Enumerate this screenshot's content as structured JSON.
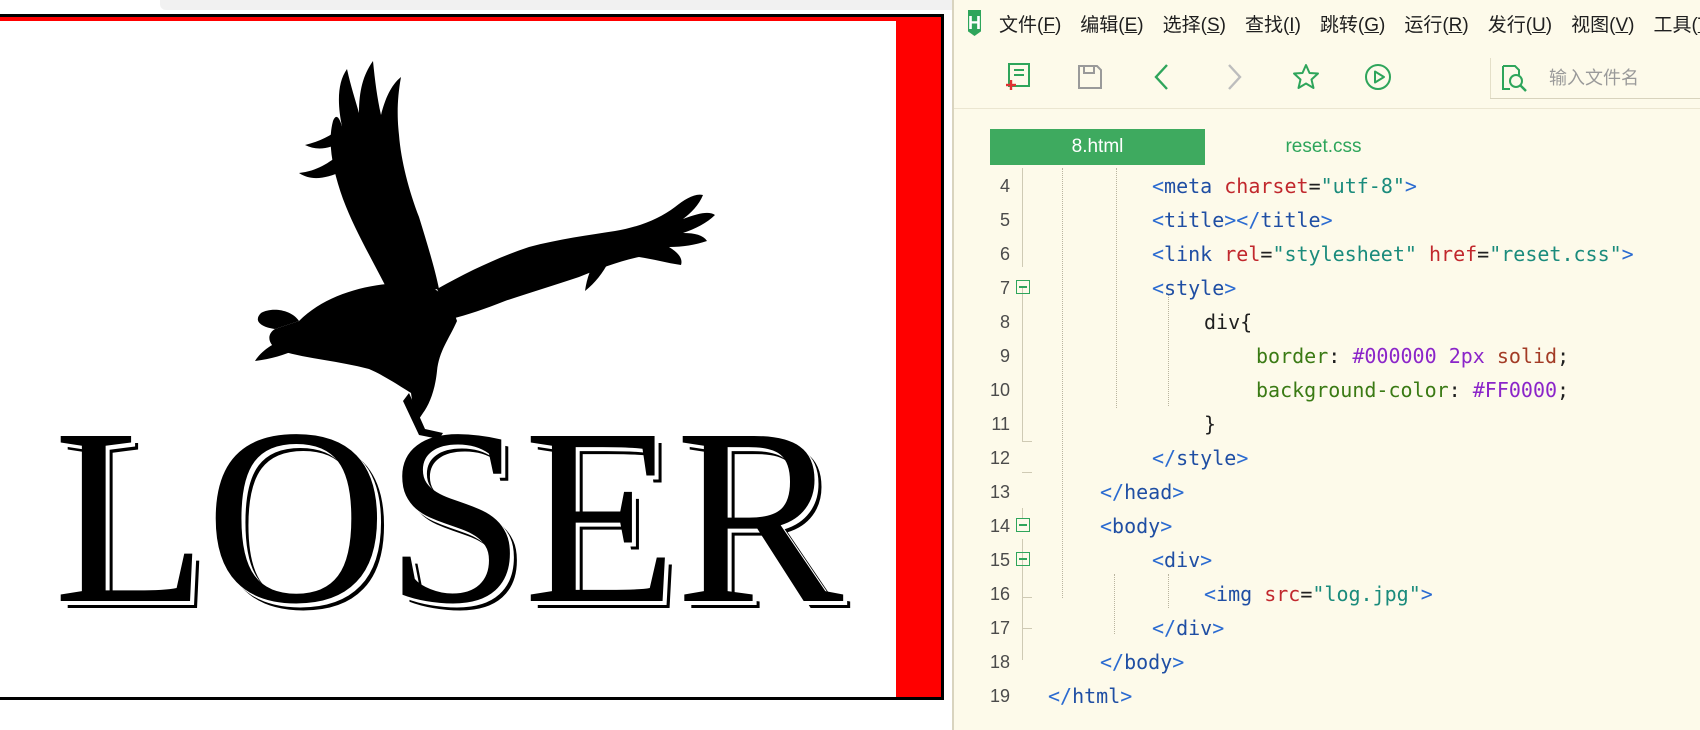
{
  "preview": {
    "logo_text": "LOSER"
  },
  "editor": {
    "app_logo": "H",
    "menu": [
      {
        "text": "文件(",
        "key": "F",
        "end": ")"
      },
      {
        "text": "编辑(",
        "key": "E",
        "end": ")"
      },
      {
        "text": "选择(",
        "key": "S",
        "end": ")"
      },
      {
        "text": "查找(",
        "key": "I",
        "end": ")"
      },
      {
        "text": "跳转(",
        "key": "G",
        "end": ")"
      },
      {
        "text": "运行(",
        "key": "R",
        "end": ")"
      },
      {
        "text": "发行(",
        "key": "U",
        "end": ")"
      },
      {
        "text": "视图(",
        "key": "V",
        "end": ")"
      },
      {
        "text": "工具(",
        "key": "T",
        "end": ""
      }
    ],
    "toolbar": {
      "icons": [
        "new-file-icon",
        "save-icon",
        "back-icon",
        "forward-icon",
        "star-icon",
        "run-icon",
        "file-search-icon"
      ],
      "search_placeholder": "输入文件名"
    },
    "tabs": {
      "active": "8.html",
      "inactive": "reset.css"
    },
    "colors": {
      "accent": "#3eaa5f",
      "editor_bg": "#fdfaea",
      "preview_border": "#000000",
      "preview_bg": "#ff0000"
    },
    "code_lines": [
      {
        "num": "4",
        "fold": false
      },
      {
        "num": "5",
        "fold": false
      },
      {
        "num": "6",
        "fold": false
      },
      {
        "num": "7",
        "fold": true
      },
      {
        "num": "8",
        "fold": false
      },
      {
        "num": "9",
        "fold": false
      },
      {
        "num": "10",
        "fold": false
      },
      {
        "num": "11",
        "fold": false
      },
      {
        "num": "12",
        "fold": false
      },
      {
        "num": "13",
        "fold": false
      },
      {
        "num": "14",
        "fold": true
      },
      {
        "num": "15",
        "fold": true
      },
      {
        "num": "16",
        "fold": false
      },
      {
        "num": "17",
        "fold": false
      },
      {
        "num": "18",
        "fold": false
      },
      {
        "num": "19",
        "fold": false
      }
    ],
    "code": {
      "l4": {
        "open": "<",
        "tag": "meta",
        "attr": "charset",
        "eq": "=",
        "val": "\"utf-8\"",
        "close": ">"
      },
      "l5": {
        "open": "<",
        "tag": "title",
        "mid": "></",
        "tag2": "title",
        "close": ">"
      },
      "l6": {
        "open": "<",
        "tag": "link",
        "attr": "rel",
        "eq": "=",
        "val": "\"stylesheet\"",
        "attr2": "href",
        "eq2": "=",
        "val2": "\"reset.css\"",
        "close": ">"
      },
      "l7": {
        "open": "<",
        "tag": "style",
        "close": ">"
      },
      "l8": {
        "sel": "div{"
      },
      "l9": {
        "prop": "border",
        "colon": ": ",
        "v1": "#000000",
        "v2": "2px",
        "v3": "solid",
        "semi": ";"
      },
      "l10": {
        "prop": "background-color",
        "colon": ": ",
        "v1": "#FF0000",
        "semi": ";"
      },
      "l11": {
        "sel": "}"
      },
      "l12": {
        "open": "</",
        "tag": "style",
        "close": ">"
      },
      "l13": {
        "open": "</",
        "tag": "head",
        "close": ">"
      },
      "l14": {
        "open": "<",
        "tag": "body",
        "close": ">"
      },
      "l15": {
        "open": "<",
        "tag": "div",
        "close": ">"
      },
      "l16": {
        "open": "<",
        "tag": "img",
        "attr": "src",
        "eq": "=",
        "val": "\"log.jpg\"",
        "close": ">"
      },
      "l17": {
        "open": "</",
        "tag": "div",
        "close": ">"
      },
      "l18": {
        "open": "</",
        "tag": "body",
        "close": ">"
      },
      "l19": {
        "open": "</",
        "tag": "html",
        "close": ">"
      }
    }
  }
}
